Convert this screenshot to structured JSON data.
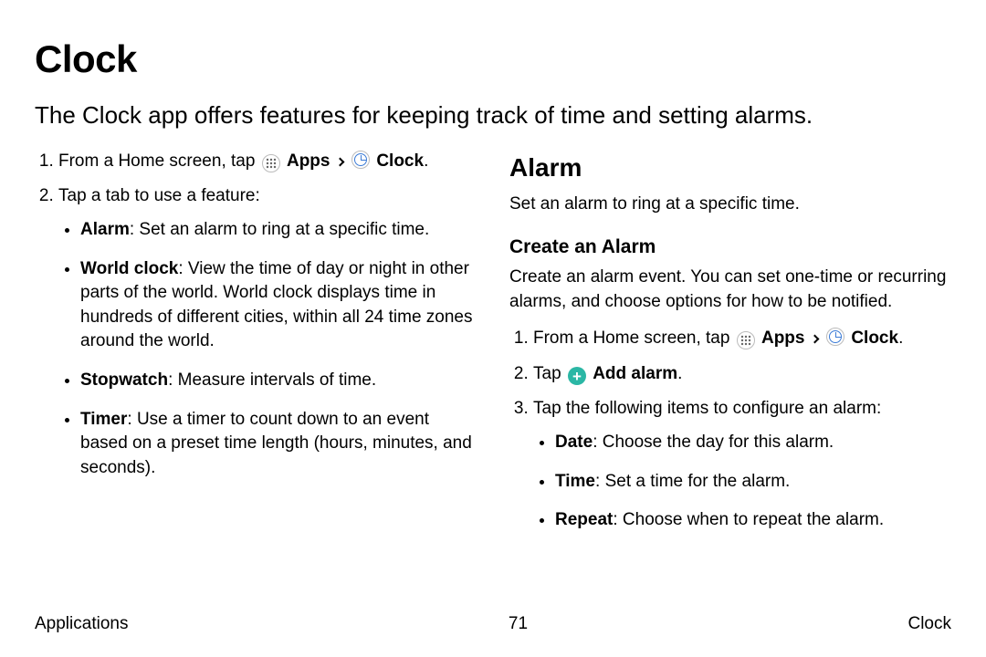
{
  "title": "Clock",
  "intro": "The Clock app offers features for keeping track of time and setting alarms.",
  "left": {
    "step1_pre": "From a Home screen, tap ",
    "apps_label": "Apps",
    "clock_label": "Clock",
    "step2": "Tap a tab to use a feature:",
    "features": [
      {
        "name": "Alarm",
        "desc": ": Set an alarm to ring at a specific time."
      },
      {
        "name": "World clock",
        "desc": ": View the time of day or night in other parts of the world. World clock displays time in hundreds of different cities, within all 24 time zones around the world."
      },
      {
        "name": "Stopwatch",
        "desc": ": Measure intervals of time."
      },
      {
        "name": "Timer",
        "desc": ": Use a timer to count down to an event based on a preset time length (hours, minutes, and seconds)."
      }
    ]
  },
  "right": {
    "heading": "Alarm",
    "desc": "Set an alarm to ring at a specific time.",
    "subheading": "Create an Alarm",
    "subdesc": "Create an alarm event. You can set one-time or recurring alarms, and choose options for how to be notified.",
    "step1_pre": "From a Home screen, tap ",
    "apps_label": "Apps",
    "clock_label": "Clock",
    "step2_pre": "Tap ",
    "add_alarm": "Add alarm",
    "step3": "Tap the following items to configure an alarm:",
    "config": [
      {
        "name": "Date",
        "desc": ": Choose the day for this alarm."
      },
      {
        "name": "Time",
        "desc": ": Set a time for the alarm."
      },
      {
        "name": "Repeat",
        "desc": ": Choose when to repeat the alarm."
      }
    ]
  },
  "footer": {
    "left": "Applications",
    "center": "71",
    "right": "Clock"
  }
}
